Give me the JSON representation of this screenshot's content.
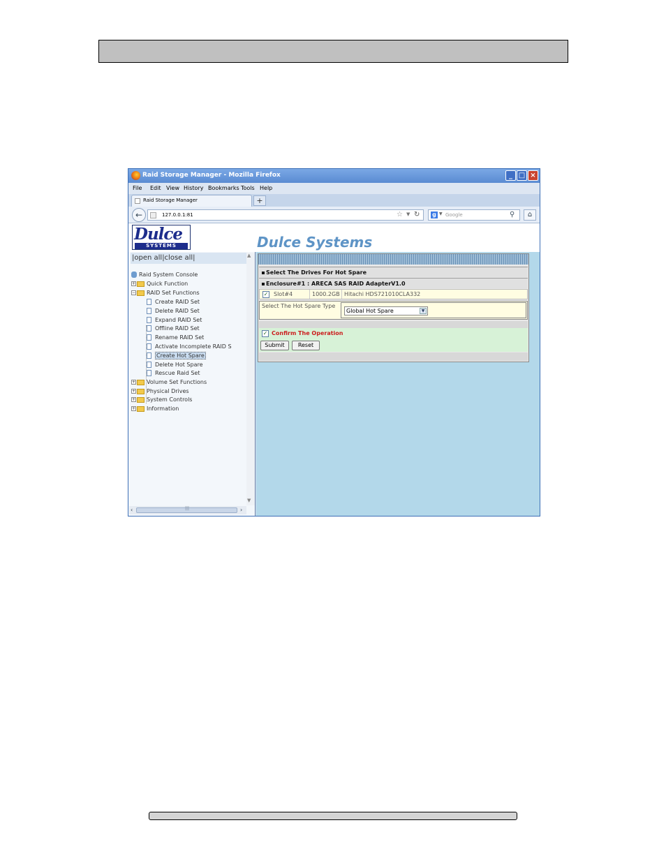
{
  "browser": {
    "title": "Raid Storage Manager - Mozilla Firefox",
    "menu": [
      "File",
      "Edit",
      "View",
      "History",
      "Bookmarks",
      "Tools",
      "Help"
    ],
    "tab_label": "Raid Storage Manager",
    "new_tab": "+",
    "url": "127.0.0.1:81",
    "search_placeholder": "Google"
  },
  "header": {
    "logo_top": "Dulce",
    "logo_bottom": "SYSTEMS",
    "brand": "Dulce Systems"
  },
  "sidebar": {
    "open_close": "|open all|close all|",
    "items": [
      {
        "label": "Raid System Console"
      },
      {
        "label": "Quick Function"
      },
      {
        "label": "RAID Set Functions"
      },
      {
        "label": "Create RAID Set"
      },
      {
        "label": "Delete RAID Set"
      },
      {
        "label": "Expand RAID Set"
      },
      {
        "label": "Offline RAID Set"
      },
      {
        "label": "Rename RAID Set"
      },
      {
        "label": "Activate Incomplete RAID S"
      },
      {
        "label": "Create Hot Spare"
      },
      {
        "label": "Delete Hot Spare"
      },
      {
        "label": "Rescue Raid Set"
      },
      {
        "label": "Volume Set Functions"
      },
      {
        "label": "Physical Drives"
      },
      {
        "label": "System Controls"
      },
      {
        "label": "Information"
      }
    ]
  },
  "form": {
    "heading": "Select The Drives For Hot Spare",
    "enclosure": "Enclosure#1 : ARECA SAS RAID AdapterV1.0",
    "drive": {
      "slot": "Slot#4",
      "capacity": "1000.2GB",
      "model": "Hitachi HDS721010CLA332",
      "checked": true
    },
    "type_label": "Select The Hot Spare Type",
    "type_value": "Global Hot Spare",
    "confirm_label": "Confirm The Operation",
    "confirm_checked": true,
    "submit": "Submit",
    "reset": "Reset"
  }
}
